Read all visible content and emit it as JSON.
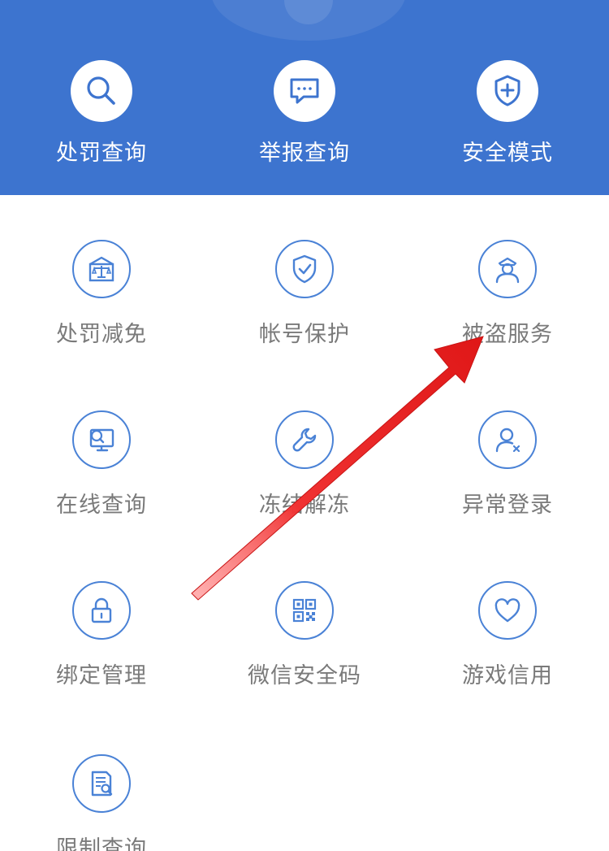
{
  "header": {
    "background_color": "#3d74cf",
    "items": [
      {
        "label": "处罚查询",
        "icon": "search-icon"
      },
      {
        "label": "举报查询",
        "icon": "chat-report-icon"
      },
      {
        "label": "安全模式",
        "icon": "shield-plus-icon"
      }
    ]
  },
  "grid": {
    "accent_color": "#4a82d6",
    "label_color": "#7a7a7a",
    "items": [
      {
        "label": "处罚减免",
        "icon": "scale-icon"
      },
      {
        "label": "帐号保护",
        "icon": "shield-check-icon"
      },
      {
        "label": "被盗服务",
        "icon": "police-officer-icon"
      },
      {
        "label": "在线查询",
        "icon": "monitor-search-icon"
      },
      {
        "label": "冻结解冻",
        "icon": "wrench-icon"
      },
      {
        "label": "异常登录",
        "icon": "user-alert-icon"
      },
      {
        "label": "绑定管理",
        "icon": "lock-icon"
      },
      {
        "label": "微信安全码",
        "icon": "qr-code-icon"
      },
      {
        "label": "游戏信用",
        "icon": "heart-icon"
      },
      {
        "label": "限制查询",
        "icon": "document-search-icon"
      }
    ]
  },
  "annotation": {
    "icon": "red-arrow-annotation",
    "color": "#e01818"
  }
}
